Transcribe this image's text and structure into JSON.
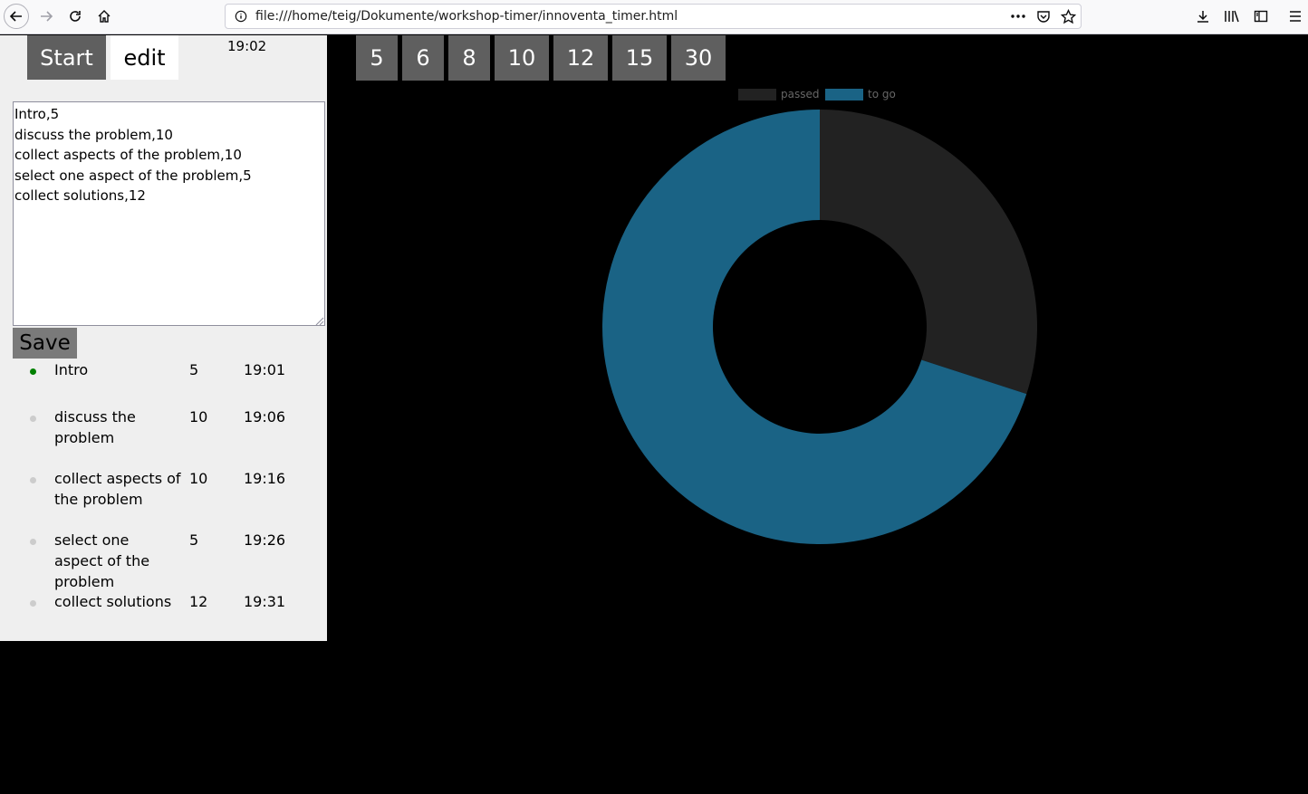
{
  "browser": {
    "url": "file:///home/teig/Dokumente/workshop-timer/innoventa_timer.html"
  },
  "panel": {
    "start_label": "Start",
    "edit_label": "edit",
    "clock": "19:02",
    "editor_text": "Intro,5\ndiscuss the problem,10\ncollect aspects of the problem,10\nselect one aspect of the problem,5\ncollect solutions,12",
    "save_label": "Save",
    "agenda": [
      {
        "name": "Intro",
        "minutes": "5",
        "time": "19:01",
        "active": true
      },
      {
        "name": "discuss the problem",
        "minutes": "10",
        "time": "19:06",
        "active": false
      },
      {
        "name": "collect aspects of the problem",
        "minutes": "10",
        "time": "19:16",
        "active": false
      },
      {
        "name": "select one aspect of the problem",
        "minutes": "5",
        "time": "19:26",
        "active": false
      },
      {
        "name": "collect solutions",
        "minutes": "12",
        "time": "19:31",
        "active": false
      }
    ]
  },
  "quick_minutes": [
    "5",
    "6",
    "8",
    "10",
    "12",
    "15",
    "30"
  ],
  "colors": {
    "passed": "#222222",
    "to_go": "#1a6385",
    "active_dot": "#008000",
    "inactive_dot": "#cccccc"
  },
  "chart_data": {
    "type": "pie",
    "style": "doughnut",
    "series": [
      {
        "name": "passed",
        "value": 30
      },
      {
        "name": "to go",
        "value": 70
      }
    ],
    "legend": [
      "passed",
      "to go"
    ],
    "legend_position": "top"
  }
}
